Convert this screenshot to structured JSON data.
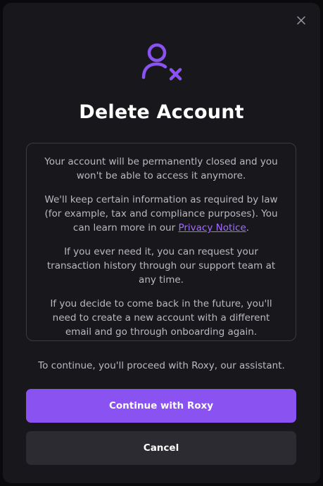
{
  "dialog": {
    "title": "Delete Account",
    "close_icon": "close-icon",
    "hero_icon": "user-remove-icon",
    "accent_color": "#8b52f2"
  },
  "info": {
    "paragraph_1": "Your account will be permanently closed and you won't be able to access it anymore.",
    "paragraph_2_before": "We'll keep certain information as required by law (for example, tax and compliance purposes). You can learn more in our ",
    "paragraph_2_link": "Privacy Notice",
    "paragraph_2_after": ".",
    "paragraph_3": "If you ever need it, you can request your transaction history through our support team at any time.",
    "paragraph_4": "If you decide to come back in the future, you'll need to create a new account with a different email and go through onboarding again."
  },
  "note": "To continue, you'll proceed with Roxy, our assistant.",
  "buttons": {
    "primary_label": "Continue with Roxy",
    "secondary_label": "Cancel"
  }
}
